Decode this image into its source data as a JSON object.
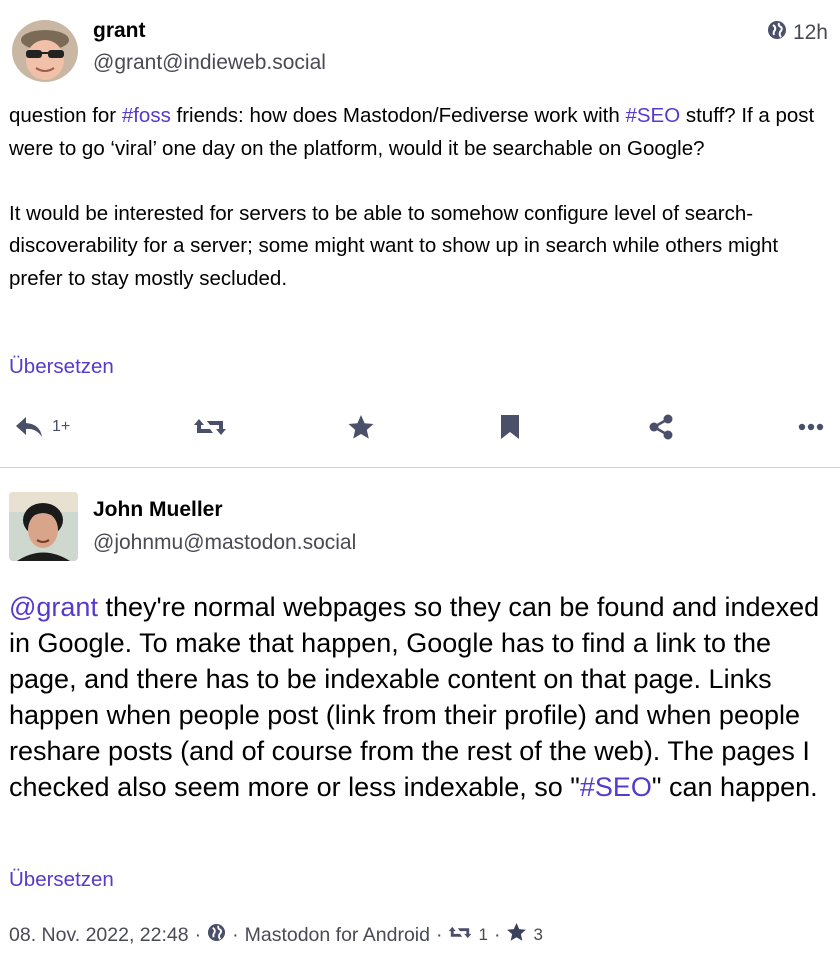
{
  "post1": {
    "display_name": "grant",
    "handle": "@grant@indieweb.social",
    "time": "12h",
    "paragraph1": [
      {
        "text": "question for ",
        "link": false
      },
      {
        "text": "#foss",
        "link": true
      },
      {
        "text": " friends: how does Mastodon/Fediverse work with ",
        "link": false
      },
      {
        "text": "#SEO",
        "link": true
      },
      {
        "text": " stuff? If a post were to go ‘viral’ one day on the platform, would it be searchable on Google?",
        "link": false
      }
    ],
    "paragraph2": "It would be interested for servers to be able to somehow configure level of search-discoverability for a server; some might want to show up in search while others might prefer to stay mostly secluded.",
    "translate_label": "Übersetzen",
    "actions": {
      "reply_count": "1+"
    }
  },
  "post2": {
    "display_name": "John Mueller",
    "handle": "@johnmu@mastodon.social",
    "content": [
      {
        "text": "@grant",
        "link": true
      },
      {
        "text": " they're normal webpages so they can be found and indexed in Google. To make that happen, Google has to find a link to the page, and there has to be indexable content on that page. Links happen when people post (link from their profile) and when people reshare posts (and of course from the rest of the web). The pages I checked also seem more or less indexable, so \"",
        "link": false
      },
      {
        "text": "#SEO",
        "link": true
      },
      {
        "text": "\" can happen.",
        "link": false
      }
    ],
    "translate_label": "Übersetzen",
    "meta": {
      "date": "08. Nov. 2022, 22:48",
      "separator": "·",
      "app": "Mastodon for Android",
      "boosts": "1",
      "favourites": "3"
    }
  },
  "colors": {
    "link": "#563acc",
    "icon": "#4a4f6a",
    "secondary_text": "#4a4a55",
    "divider": "#cfcfd6"
  },
  "icons": [
    "globe-icon",
    "reply-icon",
    "boost-icon",
    "favourite-icon",
    "bookmark-icon",
    "share-icon",
    "more-icon"
  ]
}
